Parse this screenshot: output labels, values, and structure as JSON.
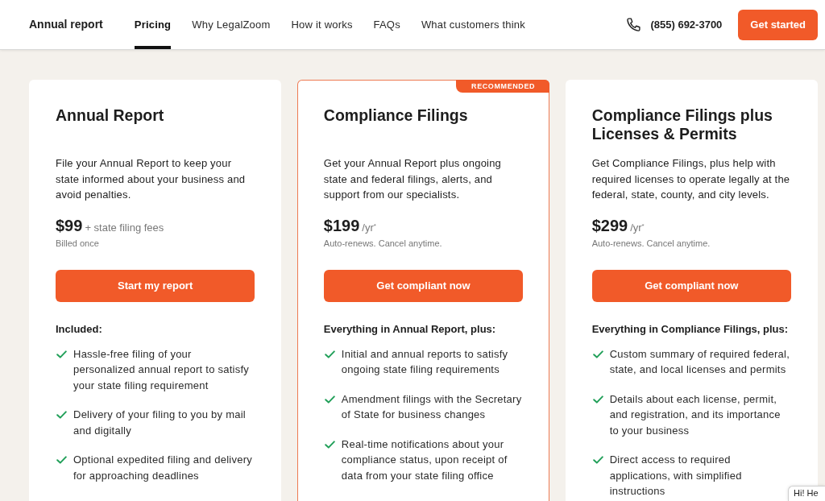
{
  "header": {
    "title": "Annual report",
    "nav": [
      {
        "label": "Pricing",
        "selected": true
      },
      {
        "label": "Why LegalZoom",
        "selected": false
      },
      {
        "label": "How it works",
        "selected": false
      },
      {
        "label": "FAQs",
        "selected": false
      },
      {
        "label": "What customers think",
        "selected": false
      }
    ],
    "phone": "(855) 692-3700",
    "cta": "Get started"
  },
  "plans": [
    {
      "name": "Annual Report",
      "recommended": false,
      "description": "File your Annual Report to keep your state informed about your business and avoid penalties.",
      "price": "$99",
      "price_note": "+ state filing fees",
      "billing": "Billed once",
      "button": "Start my report",
      "features_heading": "Included:",
      "features": [
        "Hassle-free filing of your personalized annual report to satisfy your state filing requirement",
        "Delivery of your filing to you by mail and digitally",
        "Optional expedited filing and delivery for approaching deadlines"
      ]
    },
    {
      "name": "Compliance Filings",
      "recommended": true,
      "badge": "RECOMMENDED",
      "description": "Get your Annual Report plus ongoing state and federal filings, alerts, and support from our specialists.",
      "price": "$199",
      "price_note": "/yr$^{*}$",
      "billing": "Auto-renews. Cancel anytime.",
      "button": "Get compliant now",
      "features_heading": "Everything in Annual Report, plus:",
      "features": [
        "Initial and annual reports to satisfy ongoing state filing requirements",
        "Amendment filings with the Secretary of State for business changes",
        "Real-time notifications about your compliance status, upon receipt of data from your state filing office"
      ]
    },
    {
      "name": "Compliance Filings plus Licenses & Permits",
      "recommended": false,
      "description": "Get Compliance Filings, plus help with required licenses to operate legally at the federal, state, county, and city levels.",
      "price": "$299",
      "price_note": "/yr$^{*}$",
      "billing": "Auto-renews. Cancel anytime.",
      "button": "Get compliant now",
      "features_heading": "Everything in Compliance Filings, plus:",
      "features": [
        "Custom summary of required federal, state, and local licenses and permits",
        "Details about each license, permit, and registration, and its importance to your business",
        "Direct access to required applications, with simplified instructions"
      ]
    }
  ],
  "chat_widget": {
    "text": "Hi! He"
  }
}
